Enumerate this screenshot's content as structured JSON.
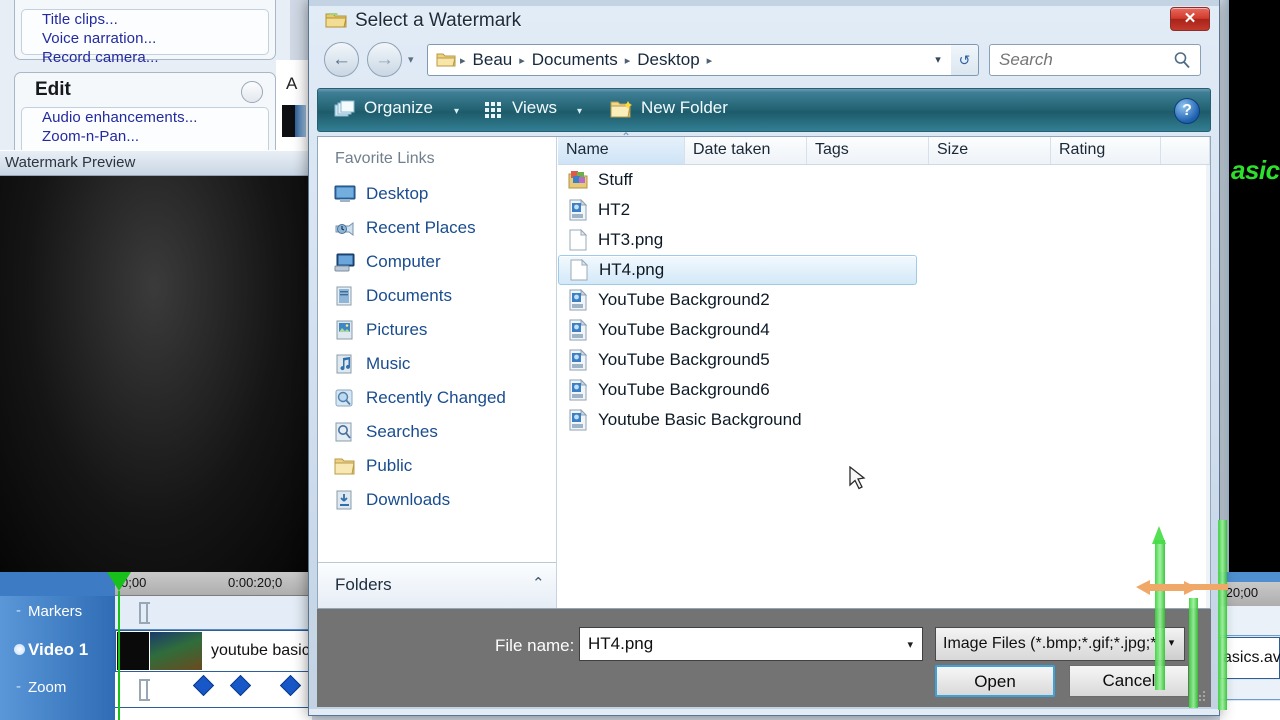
{
  "background_app": {
    "left_panel": {
      "tasks_links": [
        "Title clips...",
        "Voice narration...",
        "Record camera..."
      ],
      "edit_section": {
        "heading": "Edit",
        "collapse_icon": "chevron-up-icon",
        "links": [
          "Audio enhancements...",
          "Zoom-n-Pan..."
        ]
      },
      "letter_marker": "A"
    },
    "preview": {
      "title": "Watermark Preview"
    },
    "timeline": {
      "ruler_left_label": "0;00",
      "ruler_right_label": "0:00:20;0",
      "ruler_right_label_far": ":20;00",
      "tracks": [
        {
          "name": "Markers",
          "toggle": "-"
        },
        {
          "name": "Video 1",
          "toggle": "•",
          "clip_label": "youtube basic"
        },
        {
          "name": "Zoom",
          "toggle": "-"
        }
      ],
      "lock_icon": "unlock-icon"
    },
    "right_strip": {
      "green_text": "asics",
      "clip_name": "asics.av"
    }
  },
  "dialog": {
    "title": "Select a Watermark",
    "title_icon": "folder-icon",
    "close_label": "✕",
    "nav": {
      "back_icon": "arrow-left-icon",
      "forward_icon": "arrow-right-icon",
      "history_caret": "▾",
      "breadcrumb": [
        "Beau",
        "Documents",
        "Desktop"
      ],
      "breadcrumb_separator": "▸",
      "address_caret": "▾",
      "refresh_icon": "refresh-icon"
    },
    "search": {
      "placeholder": "Search",
      "value": "",
      "icon": "search-icon"
    },
    "toolbar": {
      "organize_label": "Organize",
      "organize_icon": "stack-icon",
      "organize_caret": "▾",
      "views_label": "Views",
      "views_icon": "grid-icon",
      "views_caret": "▾",
      "new_folder_label": "New Folder",
      "new_folder_icon": "new-folder-icon",
      "help_label": "?"
    },
    "favorites": {
      "heading": "Favorite Links",
      "items": [
        {
          "label": "Desktop",
          "icon": "desktop-icon"
        },
        {
          "label": "Recent Places",
          "icon": "recent-places-icon"
        },
        {
          "label": "Computer",
          "icon": "computer-icon"
        },
        {
          "label": "Documents",
          "icon": "documents-icon"
        },
        {
          "label": "Pictures",
          "icon": "pictures-icon"
        },
        {
          "label": "Music",
          "icon": "music-icon"
        },
        {
          "label": "Recently Changed",
          "icon": "recently-changed-icon"
        },
        {
          "label": "Searches",
          "icon": "searches-icon"
        },
        {
          "label": "Public",
          "icon": "public-folder-icon"
        },
        {
          "label": "Downloads",
          "icon": "downloads-icon"
        }
      ],
      "footer_label": "Folders",
      "footer_caret": "⌃"
    },
    "file_list": {
      "columns": [
        {
          "label": "Name",
          "sorted": true
        },
        {
          "label": "Date taken",
          "sorted": false
        },
        {
          "label": "Tags",
          "sorted": false
        },
        {
          "label": "Size",
          "sorted": false
        },
        {
          "label": "Rating",
          "sorted": false
        }
      ],
      "rows": [
        {
          "name": "Stuff",
          "icon": "folder-pictures-icon",
          "selected": false
        },
        {
          "name": "HT2",
          "icon": "png-image-icon",
          "selected": false
        },
        {
          "name": "HT3.png",
          "icon": "blank-file-icon",
          "selected": false
        },
        {
          "name": "HT4.png",
          "icon": "blank-file-icon",
          "selected": true
        },
        {
          "name": "YouTube Background2",
          "icon": "png-image-icon",
          "selected": false
        },
        {
          "name": "YouTube Background4",
          "icon": "png-image-icon",
          "selected": false
        },
        {
          "name": "YouTube Background5",
          "icon": "png-image-icon",
          "selected": false
        },
        {
          "name": "YouTube Background6",
          "icon": "png-image-icon",
          "selected": false
        },
        {
          "name": "Youtube Basic Background",
          "icon": "png-image-icon",
          "selected": false
        }
      ]
    },
    "footer": {
      "file_name_label": "File name:",
      "file_name_value": "HT4.png",
      "file_name_caret": "▾",
      "file_type_value": "Image Files (*.bmp;*.gif;*.jpg;*.p",
      "file_type_caret": "▾",
      "open_label": "Open",
      "cancel_label": "Cancel"
    }
  },
  "colors": {
    "toolbar_teal": "#20606f",
    "selection_blue": "#d3e9f8",
    "link_blue": "#1a4d8f",
    "close_red": "#d13a2c",
    "annotation_green": "#38d238",
    "annotation_orange": "#f0a868"
  }
}
